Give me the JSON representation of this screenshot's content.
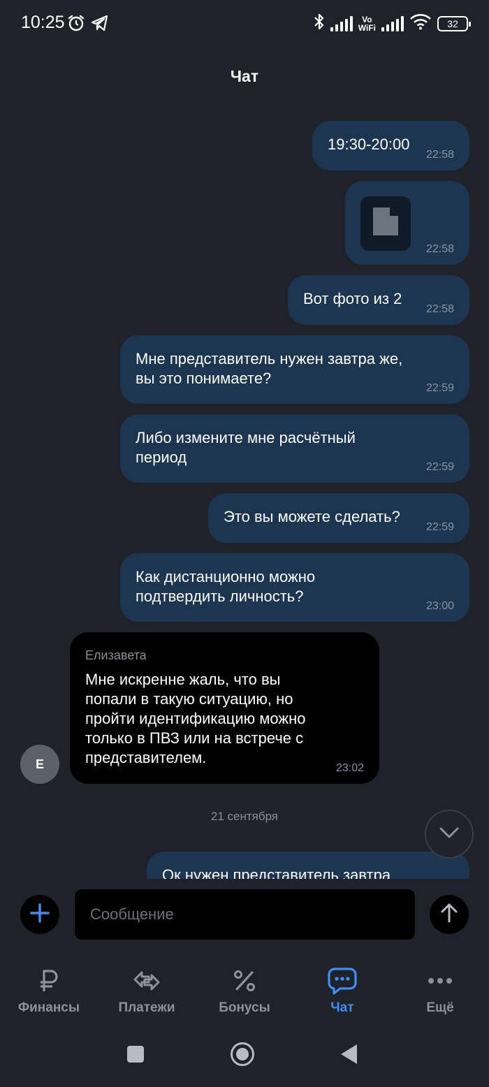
{
  "status": {
    "time": "10:25",
    "vowifi_top": "Vo",
    "vowifi_bottom": "WiFi",
    "battery": "32"
  },
  "header": {
    "title": "Чат"
  },
  "messages": [
    {
      "text": "19:30-20:00",
      "time": "22:58"
    },
    {
      "attachment": "file-icon",
      "time": "22:58"
    },
    {
      "text": "Вот фото из 2",
      "time": "22:58"
    },
    {
      "text": "Мне представитель нужен завтра же, вы это понимаете?",
      "time": "22:59"
    },
    {
      "text": "Либо измените мне расчётный период",
      "time": "22:59"
    },
    {
      "text": "Это вы можете сделать?",
      "time": "22:59"
    },
    {
      "text": "Как дистанционно можно подтвердить личность?",
      "time": "23:00"
    },
    {
      "sender": "Елизавета",
      "avatar": "Е",
      "text": "Мне искренне жаль, что вы попали в такую ситуацию, но пройти идентификацию можно только в ПВЗ или на встрече с представителем.",
      "time": "23:02"
    },
    {
      "text": "Ок нужен представитель завтра"
    }
  ],
  "date_separator": "21 сентября",
  "input": {
    "placeholder": "Сообщение"
  },
  "nav": [
    {
      "label": "Финансы",
      "icon": "ruble-icon"
    },
    {
      "label": "Платежи",
      "icon": "transfer-icon"
    },
    {
      "label": "Бонусы",
      "icon": "percent-icon"
    },
    {
      "label": "Чат",
      "icon": "chat-icon",
      "active": true
    },
    {
      "label": "Ещё",
      "icon": "more-icon"
    }
  ],
  "colors": {
    "background": "#1f2329",
    "outgoing_bubble": "#1c3550",
    "incoming_bubble": "#000000",
    "accent": "#3d8ef5"
  }
}
